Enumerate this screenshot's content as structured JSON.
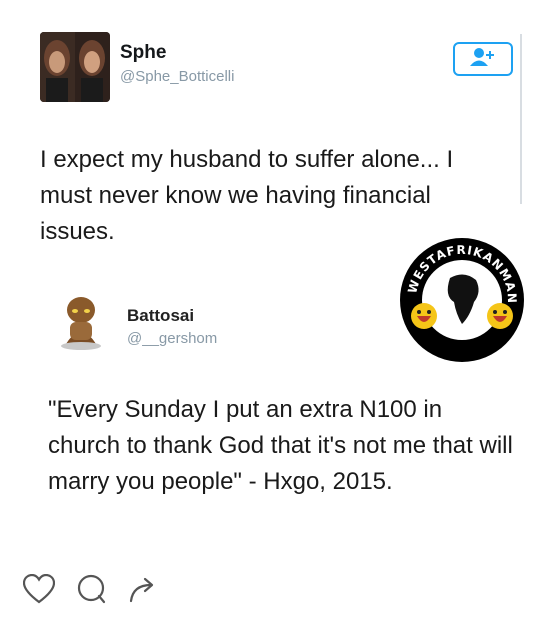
{
  "tweet": {
    "name": "Sphe",
    "handle": "@Sphe_Botticelli",
    "text": "I expect my husband to suffer alone... I must never know we having financial issues."
  },
  "quote": {
    "name": "Battosai",
    "handle": "@__gershom",
    "text": "\"Every Sunday I put an extra N100 in church to thank God that it's not me that will marry you people\" - Hxgo, 2015."
  },
  "watermark": {
    "text": "WESTAFRIKANMAN"
  },
  "icons": {
    "follow": "add-user-icon",
    "like": "heart-icon",
    "comment": "comment-bubble-icon",
    "share": "share-arrow-icon"
  },
  "colors": {
    "accent": "#1da1f2",
    "handle": "#8899a6"
  }
}
